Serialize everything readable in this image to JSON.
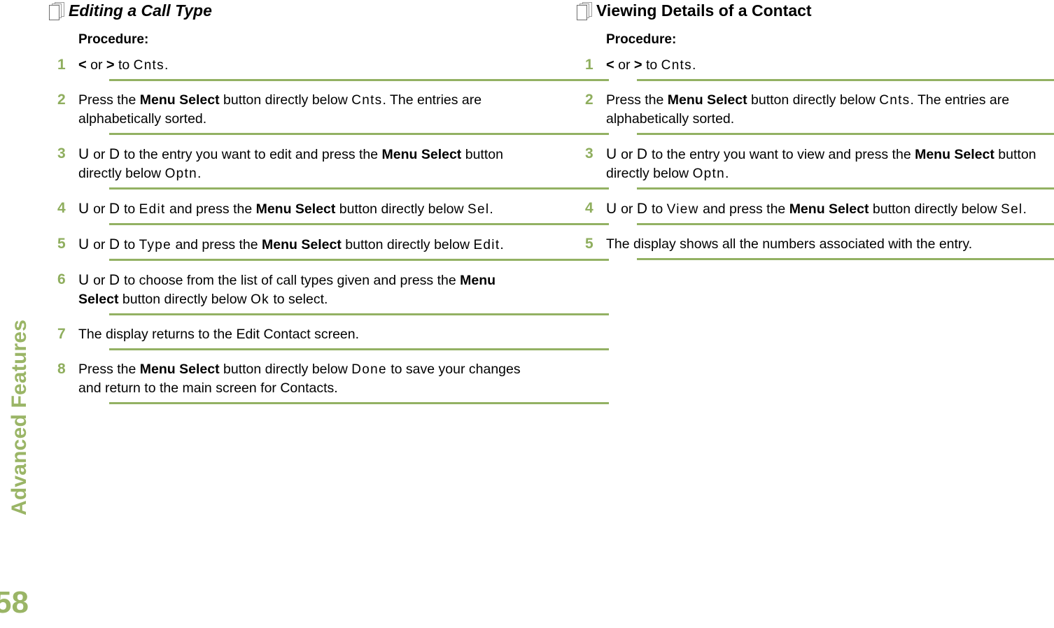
{
  "page": {
    "chapter_tab": "Advanced Features",
    "page_number": "58",
    "accent_green": "#8FAE5E",
    "tab_green": "#9AB566",
    "rule_green": "#93B163"
  },
  "icons": {
    "pages_stack": "pages-stack-icon"
  },
  "columns": [
    {
      "id": "left",
      "title": "Editing a Call Type",
      "title_italic": true,
      "procedure_label": "Procedure:",
      "steps": [
        {
          "num": "1",
          "runs": [
            {
              "t": "<",
              "s": "chev"
            },
            {
              "t": " or ",
              "s": "p"
            },
            {
              "t": ">",
              "s": "chev"
            },
            {
              "t": " to ",
              "s": "p"
            },
            {
              "t": "Cnts",
              "s": "mono"
            },
            {
              "t": ".",
              "s": "p"
            }
          ]
        },
        {
          "num": "2",
          "runs": [
            {
              "t": "Press the ",
              "s": "p"
            },
            {
              "t": "Menu Select",
              "s": "b"
            },
            {
              "t": " button directly below ",
              "s": "p"
            },
            {
              "t": "Cnts",
              "s": "mono"
            },
            {
              "t": ". The entries are alphabetically sorted.",
              "s": "p"
            }
          ]
        },
        {
          "num": "3",
          "runs": [
            {
              "t": "U",
              "s": "key"
            },
            {
              "t": " or ",
              "s": "p"
            },
            {
              "t": "D",
              "s": "key"
            },
            {
              "t": " to the entry you want to edit and press the ",
              "s": "p"
            },
            {
              "t": "Menu Select",
              "s": "b"
            },
            {
              "t": " button directly below ",
              "s": "p"
            },
            {
              "t": "Optn",
              "s": "mono"
            },
            {
              "t": ".",
              "s": "p"
            }
          ]
        },
        {
          "num": "4",
          "runs": [
            {
              "t": "U",
              "s": "key"
            },
            {
              "t": " or ",
              "s": "p"
            },
            {
              "t": "D",
              "s": "key"
            },
            {
              "t": " to ",
              "s": "p"
            },
            {
              "t": "Edit",
              "s": "mono"
            },
            {
              "t": " and press the ",
              "s": "p"
            },
            {
              "t": "Menu Select",
              "s": "b"
            },
            {
              "t": " button directly below ",
              "s": "p"
            },
            {
              "t": "Sel",
              "s": "mono"
            },
            {
              "t": ".",
              "s": "p"
            }
          ]
        },
        {
          "num": "5",
          "runs": [
            {
              "t": "U",
              "s": "key"
            },
            {
              "t": " or ",
              "s": "p"
            },
            {
              "t": "D",
              "s": "key"
            },
            {
              "t": " to ",
              "s": "p"
            },
            {
              "t": "Type",
              "s": "mono"
            },
            {
              "t": " and press the ",
              "s": "p"
            },
            {
              "t": "Menu Select",
              "s": "b"
            },
            {
              "t": " button directly below ",
              "s": "p"
            },
            {
              "t": "Edit",
              "s": "mono"
            },
            {
              "t": ".",
              "s": "p"
            }
          ]
        },
        {
          "num": "6",
          "runs": [
            {
              "t": "U",
              "s": "key"
            },
            {
              "t": " or ",
              "s": "p"
            },
            {
              "t": "D",
              "s": "key"
            },
            {
              "t": " to choose from the list of call types given and press the ",
              "s": "p"
            },
            {
              "t": "Menu Select",
              "s": "b"
            },
            {
              "t": " button directly below ",
              "s": "p"
            },
            {
              "t": "Ok",
              "s": "mono"
            },
            {
              "t": " to select.",
              "s": "p"
            }
          ]
        },
        {
          "num": "7",
          "runs": [
            {
              "t": "The display returns to the Edit Contact screen.",
              "s": "p"
            }
          ]
        },
        {
          "num": "8",
          "runs": [
            {
              "t": "Press the ",
              "s": "p"
            },
            {
              "t": "Menu Select",
              "s": "b"
            },
            {
              "t": " button directly below ",
              "s": "p"
            },
            {
              "t": "Done",
              "s": "mono"
            },
            {
              "t": " to save your changes and return to the main screen for Contacts.",
              "s": "p"
            }
          ]
        }
      ]
    },
    {
      "id": "right",
      "title": "Viewing Details of a Contact",
      "title_italic": false,
      "procedure_label": "Procedure:",
      "steps": [
        {
          "num": "1",
          "runs": [
            {
              "t": "<",
              "s": "chev"
            },
            {
              "t": " or ",
              "s": "p"
            },
            {
              "t": ">",
              "s": "chev"
            },
            {
              "t": " to ",
              "s": "p"
            },
            {
              "t": "Cnts",
              "s": "mono"
            },
            {
              "t": ".",
              "s": "p"
            }
          ]
        },
        {
          "num": "2",
          "runs": [
            {
              "t": "Press the ",
              "s": "p"
            },
            {
              "t": "Menu Select",
              "s": "b"
            },
            {
              "t": " button directly below ",
              "s": "p"
            },
            {
              "t": "Cnts",
              "s": "mono"
            },
            {
              "t": ". The entries are alphabetically sorted.",
              "s": "p"
            }
          ]
        },
        {
          "num": "3",
          "runs": [
            {
              "t": "U",
              "s": "key"
            },
            {
              "t": " or ",
              "s": "p"
            },
            {
              "t": "D",
              "s": "key"
            },
            {
              "t": " to the entry you want to view and press the ",
              "s": "p"
            },
            {
              "t": "Menu Select",
              "s": "b"
            },
            {
              "t": " button directly below ",
              "s": "p"
            },
            {
              "t": "Optn",
              "s": "mono"
            },
            {
              "t": ".",
              "s": "p"
            }
          ]
        },
        {
          "num": "4",
          "runs": [
            {
              "t": "U",
              "s": "key"
            },
            {
              "t": " or ",
              "s": "p"
            },
            {
              "t": "D",
              "s": "key"
            },
            {
              "t": " to ",
              "s": "p"
            },
            {
              "t": "View",
              "s": "mono"
            },
            {
              "t": " and press the ",
              "s": "p"
            },
            {
              "t": "Menu Select",
              "s": "b"
            },
            {
              "t": " button directly below ",
              "s": "p"
            },
            {
              "t": "Sel",
              "s": "mono"
            },
            {
              "t": ".",
              "s": "p"
            }
          ]
        },
        {
          "num": "5",
          "runs": [
            {
              "t": "The display shows all the numbers associated with the entry.",
              "s": "p"
            }
          ]
        }
      ]
    }
  ]
}
